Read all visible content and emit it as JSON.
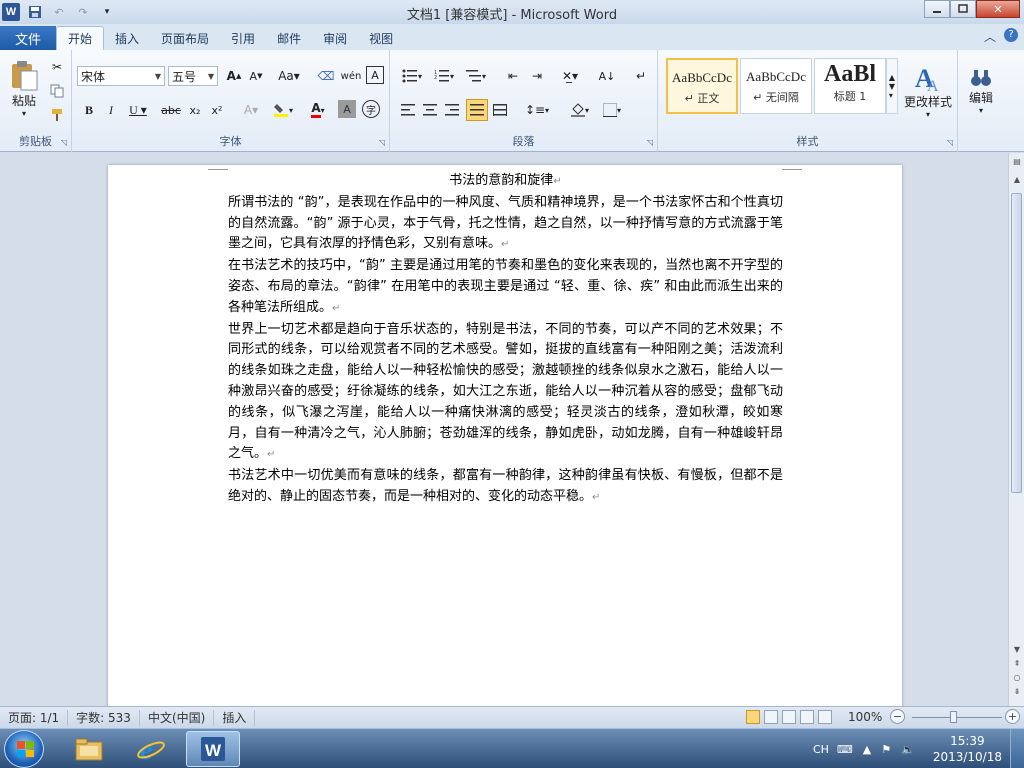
{
  "window": {
    "title": "文档1 [兼容模式] - Microsoft Word"
  },
  "tabs": {
    "file": "文件",
    "items": [
      "开始",
      "插入",
      "页面布局",
      "引用",
      "邮件",
      "审阅",
      "视图"
    ],
    "active": "开始"
  },
  "ribbon": {
    "clipboard": {
      "label": "剪贴板",
      "paste": "粘贴"
    },
    "font": {
      "label": "字体",
      "font_name": "宋体",
      "font_size": "五号"
    },
    "paragraph": {
      "label": "段落"
    },
    "styles": {
      "label": "样式",
      "items": [
        {
          "sample": "AaBbCcDc",
          "name": "↵ 正文",
          "selected": true
        },
        {
          "sample": "AaBbCcDc",
          "name": "↵ 无间隔",
          "selected": false
        },
        {
          "sample": "AaBl",
          "name": "标题 1",
          "selected": false
        }
      ],
      "change_styles": "更改样式"
    },
    "editing": {
      "label": "编辑"
    }
  },
  "document": {
    "title": "书法的意韵和旋律",
    "paragraphs": [
      "所谓书法的 “韵”，是表现在作品中的一种风度、气质和精神境界，是一个书法家怀古和个性真切的自然流露。“韵” 源于心灵，本于气骨，托之性情，趋之自然，以一种抒情写意的方式流露于笔墨之间，它具有浓厚的抒情色彩，又别有意味。",
      "在书法艺术的技巧中，“韵” 主要是通过用笔的节奏和墨色的变化来表现的，当然也离不开字型的姿态、布局的章法。“韵律” 在用笔中的表现主要是通过 “轻、重、徐、疾” 和由此而派生出来的各种笔法所组成。",
      "世界上一切艺术都是趋向于音乐状态的，特别是书法，不同的节奏，可以产不同的艺术效果；不同形式的线条，可以给观赏者不同的艺术感受。譬如，挺拔的直线富有一种阳刚之美；活泼流利的线条如珠之走盘，能给人以一种轻松愉快的感受；激越顿挫的线条似泉水之激石，能给人以一种激昂兴奋的感受；纡徐凝练的线条，如大江之东逝，能给人以一种沉着从容的感受；盘郁飞动的线条，似飞瀑之泻崖，能给人以一种痛快淋漓的感受；轻灵淡古的线条，澄如秋潭，皎如寒月，自有一种清冷之气，沁人肺腑；苍劲雄浑的线条，静如虎卧，动如龙腾，自有一种雄峻轩昂之气。",
      "书法艺术中一切优美而有意味的线条，都富有一种韵律，这种韵律虽有快板、有慢板，但都不是绝对的、静止的固态节奏，而是一种相对的、变化的动态平稳。"
    ],
    "para_mark": "↵"
  },
  "status": {
    "page": "页面: 1/1",
    "words": "字数: 533",
    "language": "中文(中国)",
    "mode": "插入",
    "zoom": "100%"
  },
  "taskbar": {
    "ime": "CH",
    "time": "15:39",
    "date": "2013/10/18"
  }
}
